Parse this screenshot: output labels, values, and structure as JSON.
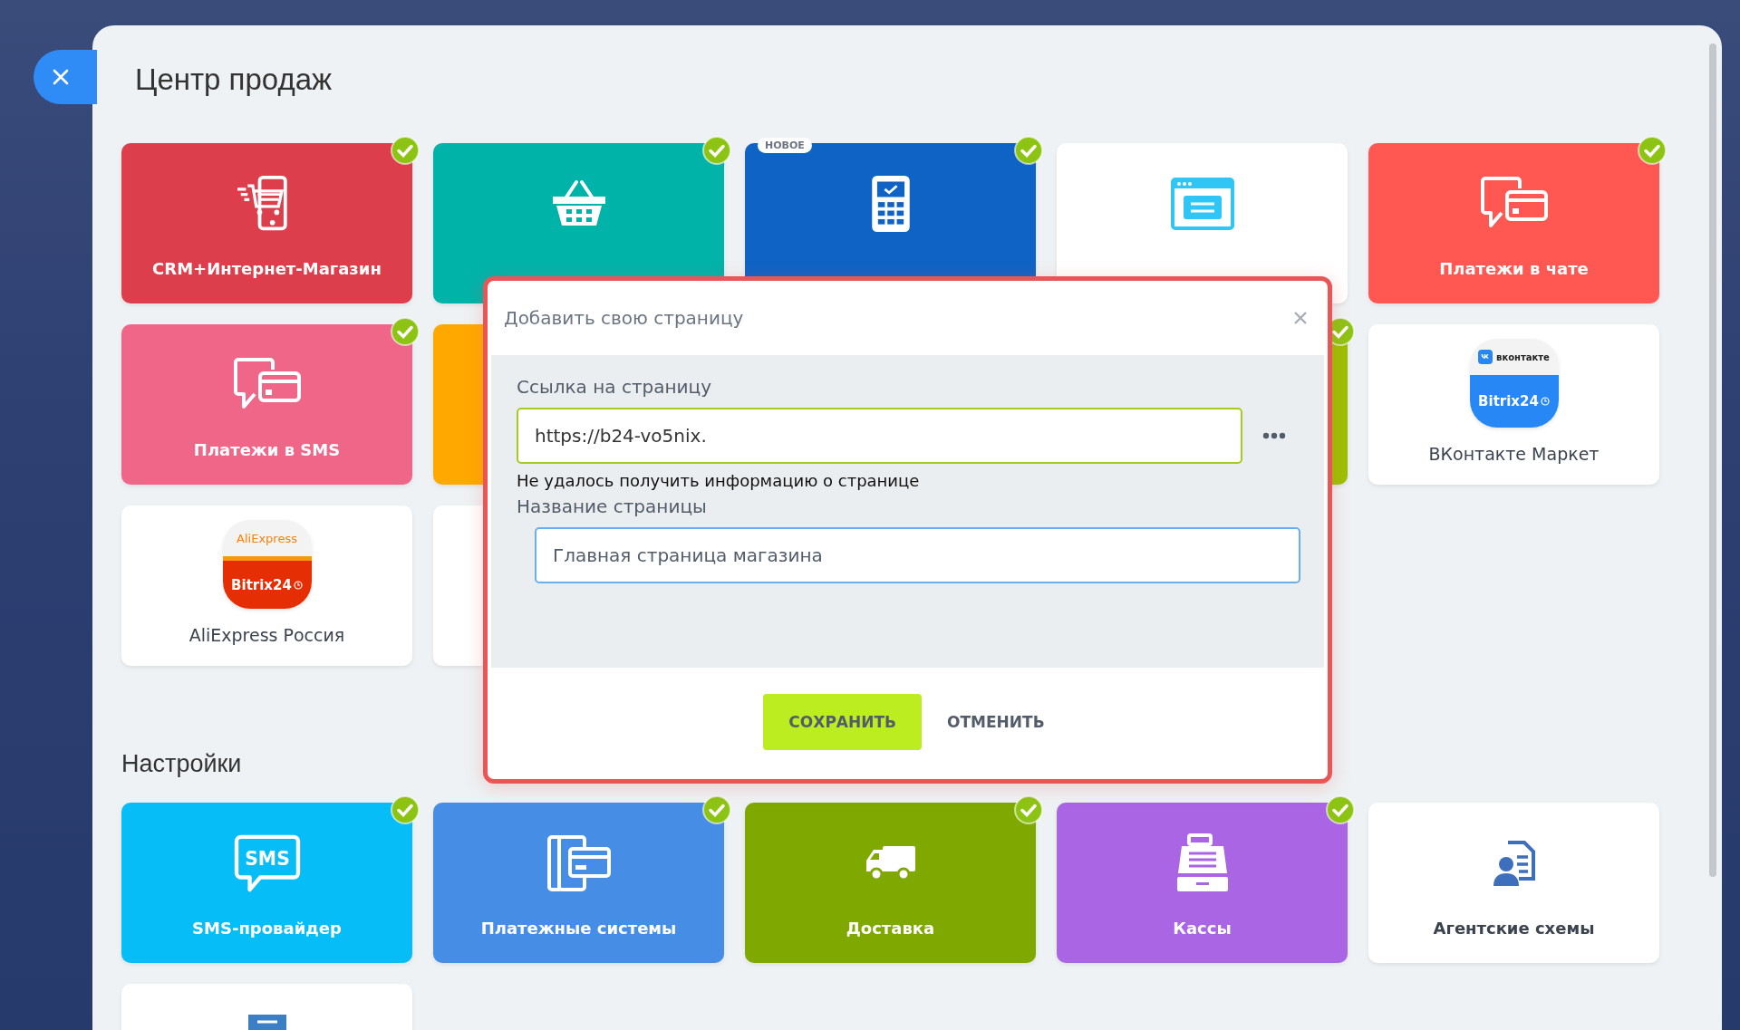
{
  "page_title": "Центр продаж",
  "sections": [
    {
      "tiles": [
        {
          "kind": "color",
          "label": "CRM+Интернет-Магазин",
          "color": "#dc3f4b",
          "checked": true
        },
        {
          "kind": "color",
          "color": "#00b3a9",
          "checked": true
        },
        {
          "kind": "color",
          "color": "#0f63c4",
          "checked": true,
          "badge": "НОВОЕ"
        },
        {
          "kind": "white",
          "checked": false
        },
        {
          "kind": "color",
          "label": "Платежи в чате",
          "color": "#ff5752",
          "checked": true
        },
        {
          "kind": "color",
          "label": "Платежи в SMS",
          "color": "#ef6689",
          "checked": true
        },
        {
          "kind": "color",
          "color": "#ffa900"
        },
        {
          "kind": "color",
          "color": "#9bc000",
          "checked": true
        },
        {
          "kind": "logo",
          "label": "ВКонтакте Маркет",
          "logo_top": "вконтакте",
          "logo_bottom": "Bitrix24",
          "color": "#2787f5",
          "checked": false
        },
        {
          "kind": "logo",
          "label": "AliExpress Россия",
          "logo_top": "AliExpress",
          "logo_bottom": "Bitrix24",
          "color": "#e62e04",
          "checked": false
        },
        {
          "kind": "white"
        }
      ]
    },
    {
      "heading": "Настройки",
      "tiles": [
        {
          "kind": "color",
          "label": "SMS-провайдер",
          "icon_text": "SMS",
          "color": "#06bdf8",
          "checked": true
        },
        {
          "kind": "color",
          "label": "Платежные системы",
          "color": "#468ee5",
          "checked": true
        },
        {
          "kind": "color",
          "label": "Доставка",
          "color": "#7fa800",
          "checked": true
        },
        {
          "kind": "color",
          "label": "Кассы",
          "color": "#a965e4",
          "checked": true
        },
        {
          "kind": "white",
          "label": "Агентские схемы",
          "checked": false
        },
        {
          "kind": "white",
          "checked": false
        }
      ]
    }
  ],
  "dialog": {
    "title": "Добавить свою страницу",
    "link_label": "Ссылка на страницу",
    "link_value": "https://b24-vo5nix.",
    "error": "Не удалось получить информацию о странице",
    "name_label": "Название страницы",
    "name_value": "Главная страница магазина",
    "buttons": [
      {
        "label": "СОХРАНИТЬ",
        "kind": "primary"
      },
      {
        "label": "ОТМЕНИТЬ",
        "kind": "link"
      }
    ]
  }
}
